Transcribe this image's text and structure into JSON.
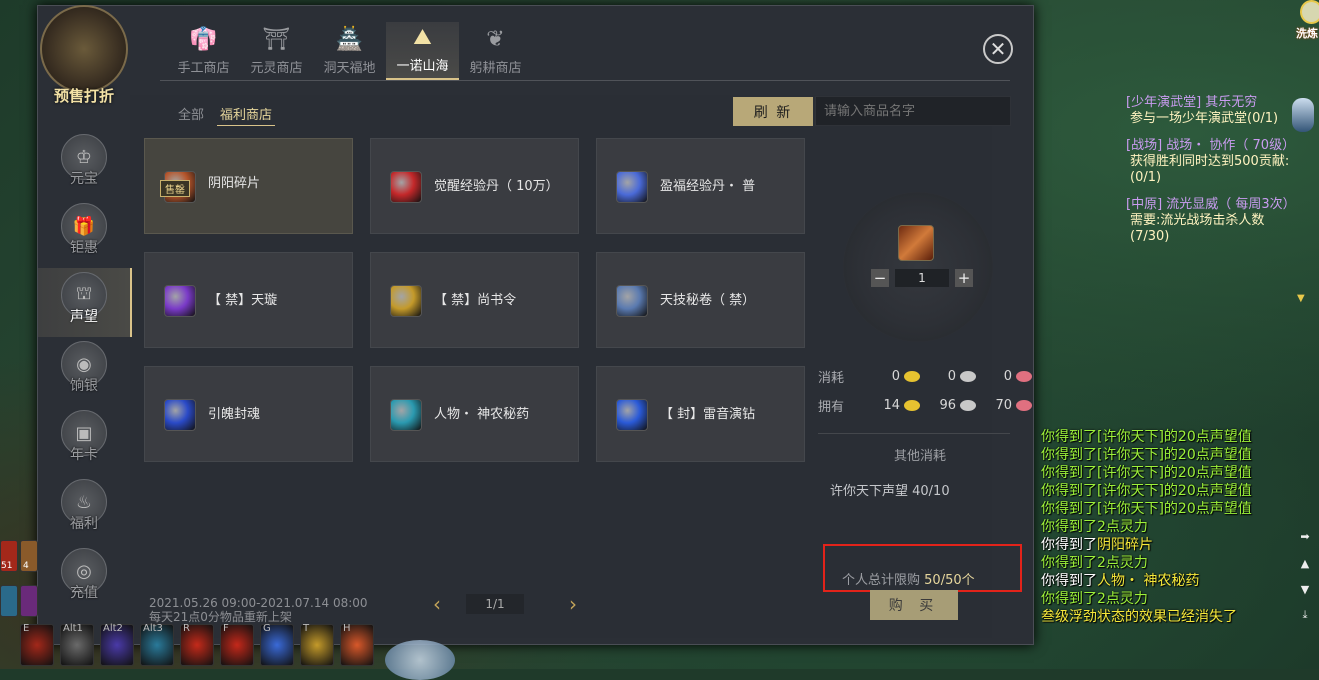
{
  "promo": {
    "label": "预售打折"
  },
  "shop_tabs": [
    {
      "label": "手工商店",
      "icon": "robe-icon",
      "active": false
    },
    {
      "label": "元灵商店",
      "icon": "shrine-icon",
      "active": false
    },
    {
      "label": "洞天福地",
      "icon": "pavilion-icon",
      "active": false
    },
    {
      "label": "一诺山海",
      "icon": "mountain-icon",
      "active": true
    },
    {
      "label": "躬耕商店",
      "icon": "plant-icon",
      "active": false
    }
  ],
  "sidebar": [
    {
      "label": "元宝",
      "icon": "ingot-icon"
    },
    {
      "label": "钜惠",
      "icon": "giftbox-icon"
    },
    {
      "label": "声望",
      "icon": "reputation-icon",
      "active": true
    },
    {
      "label": "饷银",
      "icon": "coin-icon"
    },
    {
      "label": "年卡",
      "icon": "card-icon"
    },
    {
      "label": "福利",
      "icon": "bag-icon"
    },
    {
      "label": "充值",
      "icon": "recharge-icon"
    }
  ],
  "subtabs": {
    "all": "全部",
    "welfare": "福利商店"
  },
  "toolbar": {
    "refresh": "刷 新",
    "search_placeholder": "请输入商品名字"
  },
  "items": [
    {
      "name": "阴阳碎片",
      "tag": "售罄",
      "selected": true,
      "color": "#b5542a"
    },
    {
      "name": "觉醒经验丹（ 10万）",
      "color": "#c4282a"
    },
    {
      "name": "盈福经验丹・ 普",
      "color": "#4a6ad8"
    },
    {
      "name": "【 禁】天璇",
      "color": "#7a3ac8"
    },
    {
      "name": "【 禁】尚书令",
      "color": "#c49a2a"
    },
    {
      "name": "天技秘卷（ 禁）",
      "color": "#5a7ab0"
    },
    {
      "name": "引魄封魂",
      "color": "#2a4ac8"
    },
    {
      "name": "人物・ 神农秘药",
      "color": "#2a9ab0"
    },
    {
      "name": "【 封】雷音演钻",
      "color": "#2a5ad8"
    }
  ],
  "detail": {
    "quantity": "1",
    "minus": "−",
    "plus": "+",
    "cost_label": "消耗",
    "own_label": "拥有",
    "cost": [
      "0",
      "0",
      "0"
    ],
    "own": [
      "14",
      "96",
      "70"
    ],
    "coin_colors": [
      "#e6c230",
      "#c8c8c8",
      "#e07080"
    ],
    "other_cost": "其他消耗",
    "requirement": "许你天下声望  40/10",
    "limit_label": "个人总计限购",
    "limit_value": "50/50个",
    "buy": "购 买"
  },
  "footer": {
    "dates": "2021.05.26 09:00-2021.07.14 08:00",
    "restock": "每天21点0分物品重新上架",
    "page": "1/1"
  },
  "quests": [
    {
      "title": "[少年演武堂] 其乐无穷",
      "objective": "参与一场少年演武堂(0/1)"
    },
    {
      "title": "[战场] 战场・ 协作（ 70级）",
      "objective": "获得胜利同时达到500贡献:(0/1)"
    },
    {
      "title": "[中原] 流光显威（ 每周3次）",
      "objective": "需要:流光战场击杀人数(7/30)"
    }
  ],
  "chat": [
    {
      "cls": "g",
      "text": "你得到了[许你天下]的20点声望值"
    },
    {
      "cls": "g",
      "text": "你得到了[许你天下]的20点声望值"
    },
    {
      "cls": "g",
      "text": "你得到了[许你天下]的20点声望值"
    },
    {
      "cls": "g",
      "text": "你得到了[许你天下]的20点声望值"
    },
    {
      "cls": "g",
      "text": "你得到了[许你天下]的20点声望值"
    },
    {
      "cls": "g",
      "text": "你得到了2点灵力"
    },
    {
      "cls": "w",
      "text": "你得到了",
      "hl": "阴阳碎片"
    },
    {
      "cls": "g",
      "text": "你得到了2点灵力"
    },
    {
      "cls": "w",
      "text": "你得到了",
      "hl": "人物・ 神农秘药"
    },
    {
      "cls": "g",
      "text": "你得到了2点灵力"
    },
    {
      "cls": "y",
      "text": "叁级浮劲状态的效果已经消失了"
    }
  ],
  "topright": "洗炼",
  "skill_keys": [
    "E",
    "Alt1",
    "Alt2",
    "Alt3",
    "R",
    "F",
    "G",
    "T",
    "H"
  ],
  "left_counts": [
    "51",
    "4"
  ]
}
